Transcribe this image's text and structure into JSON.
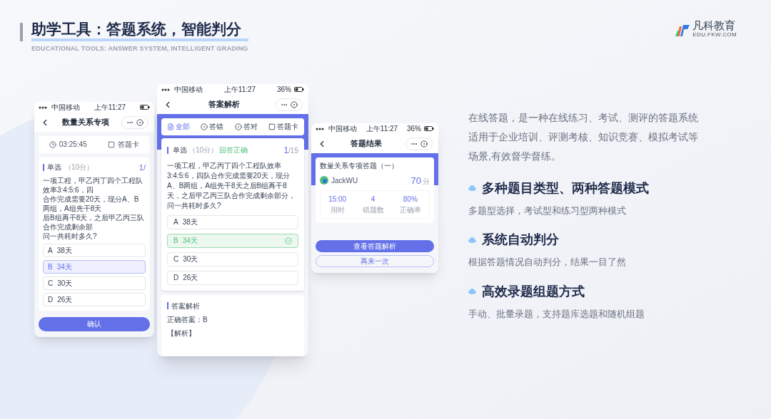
{
  "header": {
    "title": "助学工具：答题系统，智能判分",
    "subtitle": "EDUCATIONAL TOOLS: ANSWER SYSTEM, INTELLIGENT GRADING"
  },
  "logo": {
    "name": "凡科教育",
    "domain": "EDU.FKW.COM"
  },
  "phones": [
    {
      "kind": "quiz",
      "status_bar": {
        "carrier": "中国移动",
        "time": "上午11:27"
      },
      "title": "数量关系专项",
      "timer": "03:25:45",
      "card_label": "答题卡",
      "question": {
        "type": "单选",
        "points": "（10分）",
        "counter": "1/",
        "lines": [
          "一项工程，甲乙丙丁四个工程队效率3:4:5:6，四",
          "合作完成需要20天，现分A、B两组，A组先干8天",
          "后B组再干8天，之后甲乙丙三队合作完成剩余部",
          "问一共耗时多久?"
        ]
      },
      "options": [
        {
          "label": "A",
          "text": "38天",
          "selected": false
        },
        {
          "label": "B",
          "text": "34天",
          "selected": true
        },
        {
          "label": "C",
          "text": "30天",
          "selected": false
        },
        {
          "label": "D",
          "text": "26天",
          "selected": false
        }
      ],
      "confirm": "确认"
    },
    {
      "kind": "review",
      "status_bar": {
        "carrier": "中国移动",
        "time": "上午11:27",
        "battery": "36%"
      },
      "title": "答案解析",
      "tabs": [
        {
          "label": "全部",
          "selected": true
        },
        {
          "label": "答错",
          "selected": false
        },
        {
          "label": "答对",
          "selected": false
        },
        {
          "label": "答题卡",
          "selected": false
        }
      ],
      "question": {
        "type": "单选",
        "points": "（10分）",
        "result": "回答正确",
        "current": "1",
        "total": "/15",
        "text": "一项工程，甲乙丙丁四个工程队效率3:4:5:6，四队合作完成需要20天，现分A、B两组，A组先干8天之后B组再干8天，之后甲乙丙三队合作完成剩余部分，问一共耗时多久?"
      },
      "options": [
        {
          "label": "A",
          "text": "38天",
          "correct": false
        },
        {
          "label": "B",
          "text": "34天",
          "correct": true
        },
        {
          "label": "C",
          "text": "30天",
          "correct": false
        },
        {
          "label": "D",
          "text": "26天",
          "correct": false
        }
      ],
      "analysis": {
        "title": "答案解析",
        "answer": "正确答案：B",
        "section": "【解析】"
      }
    },
    {
      "kind": "result",
      "status_bar": {
        "carrier": "中国移动",
        "time": "上午11:27",
        "battery": "36%"
      },
      "title": "答题结果",
      "quiz_name": "数量关系专项答题（一）",
      "user": "JackWU",
      "score": "70",
      "score_unit": "分",
      "stats": [
        {
          "value": "15:00",
          "label": "用时"
        },
        {
          "value": "4",
          "label": "错题数"
        },
        {
          "value": "80%",
          "label": "正确率"
        }
      ],
      "primary_button": "查看答题解析",
      "secondary_button": "再来一次"
    }
  ],
  "intro": "在线答题，是一种在线练习、考试、测评的答题系统适用于企业培训、评测考核、知识竞赛、模拟考试等场景,有效督学督练。",
  "features": [
    {
      "title": "多种题目类型、两种答题模式",
      "description": "多题型选择，考试型和练习型两种模式"
    },
    {
      "title": "系统自动判分",
      "description": "根据答题情况自动判分，结果一目了然"
    },
    {
      "title": "高效录题组题方式",
      "description": "手动、批量录题，支持题库选题和随机组题"
    }
  ]
}
